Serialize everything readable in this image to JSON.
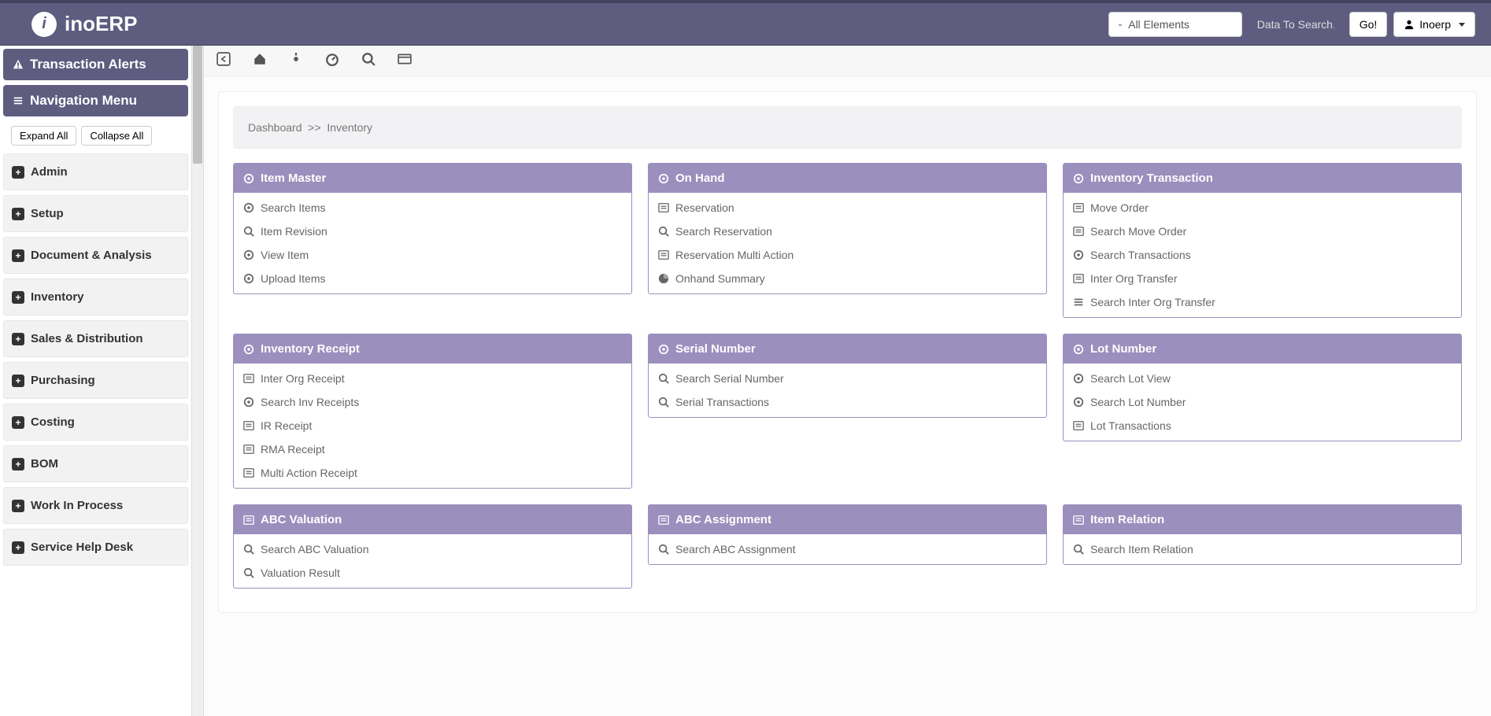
{
  "brand": {
    "name": "inoERP",
    "logo_letter": "i"
  },
  "header": {
    "elements_label": "All Elements",
    "search_placeholder": "Data To Search...",
    "go_label": "Go!",
    "user_label": "Inoerp"
  },
  "sidebar": {
    "alerts_title": "Transaction Alerts",
    "nav_title": "Navigation Menu",
    "expand_label": "Expand All",
    "collapse_label": "Collapse All",
    "items": [
      {
        "label": "Admin"
      },
      {
        "label": "Setup"
      },
      {
        "label": "Document & Analysis"
      },
      {
        "label": "Inventory"
      },
      {
        "label": "Sales & Distribution"
      },
      {
        "label": "Purchasing"
      },
      {
        "label": "Costing"
      },
      {
        "label": "BOM"
      },
      {
        "label": "Work In Process"
      },
      {
        "label": "Service Help Desk"
      }
    ]
  },
  "breadcrumb": {
    "root": "Dashboard",
    "sep": ">>",
    "current": "Inventory"
  },
  "cards": [
    {
      "title": "Item Master",
      "links": [
        {
          "icon": "target",
          "label": "Search Items"
        },
        {
          "icon": "search",
          "label": "Item Revision"
        },
        {
          "icon": "target",
          "label": "View Item"
        },
        {
          "icon": "target",
          "label": "Upload Items"
        }
      ]
    },
    {
      "title": "On Hand",
      "links": [
        {
          "icon": "list",
          "label": "Reservation"
        },
        {
          "icon": "search",
          "label": "Search Reservation"
        },
        {
          "icon": "list",
          "label": "Reservation Multi Action"
        },
        {
          "icon": "pie",
          "label": "Onhand Summary"
        }
      ]
    },
    {
      "title": "Inventory Transaction",
      "links": [
        {
          "icon": "list",
          "label": "Move Order"
        },
        {
          "icon": "list",
          "label": "Search Move Order"
        },
        {
          "icon": "target",
          "label": "Search Transactions"
        },
        {
          "icon": "list",
          "label": "Inter Org Transfer"
        },
        {
          "icon": "bars",
          "label": "Search Inter Org Transfer"
        }
      ]
    },
    {
      "title": "Inventory Receipt",
      "links": [
        {
          "icon": "list",
          "label": "Inter Org Receipt"
        },
        {
          "icon": "target",
          "label": "Search Inv Receipts"
        },
        {
          "icon": "list",
          "label": "IR Receipt"
        },
        {
          "icon": "list",
          "label": "RMA Receipt"
        },
        {
          "icon": "list",
          "label": "Multi Action Receipt"
        }
      ]
    },
    {
      "title": "Serial Number",
      "links": [
        {
          "icon": "search",
          "label": "Search Serial Number"
        },
        {
          "icon": "search",
          "label": "Serial Transactions"
        }
      ]
    },
    {
      "title": "Lot Number",
      "links": [
        {
          "icon": "target",
          "label": "Search Lot View"
        },
        {
          "icon": "target",
          "label": "Search Lot Number"
        },
        {
          "icon": "list",
          "label": "Lot Transactions"
        }
      ]
    },
    {
      "title": "ABC Valuation",
      "links": [
        {
          "icon": "search",
          "label": "Search ABC Valuation"
        },
        {
          "icon": "search",
          "label": "Valuation Result"
        }
      ]
    },
    {
      "title": "ABC Assignment",
      "links": [
        {
          "icon": "search",
          "label": "Search ABC Assignment"
        }
      ]
    },
    {
      "title": "Item Relation",
      "links": [
        {
          "icon": "search",
          "label": "Search Item Relation"
        }
      ]
    }
  ]
}
